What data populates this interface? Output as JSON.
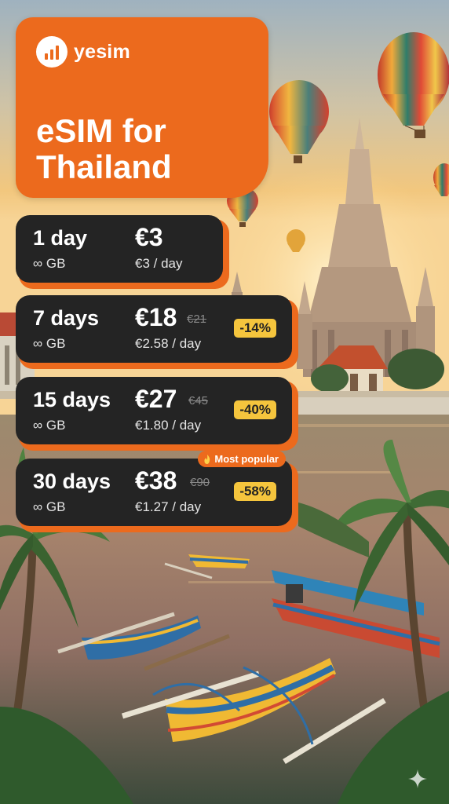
{
  "brand": {
    "name": "yesim",
    "logo_icon": "signal-bars-icon",
    "color": "#ec6a1d"
  },
  "hero": {
    "title": "eSIM for\nThailand"
  },
  "colors": {
    "accent": "#ec6a1d",
    "card": "#242424",
    "discount_badge": "#f5c53d"
  },
  "plans": [
    {
      "duration": "1 day",
      "data": "∞ GB",
      "price": "€3",
      "old_price": "",
      "per_day": "€3 / day",
      "discount": ""
    },
    {
      "duration": "7 days",
      "data": "∞ GB",
      "price": "€18",
      "old_price": "€21",
      "per_day": "€2.58 / day",
      "discount": "-14%"
    },
    {
      "duration": "15 days",
      "data": "∞ GB",
      "price": "€27",
      "old_price": "€45",
      "per_day": "€1.80 / day",
      "discount": "-40%"
    },
    {
      "duration": "30 days",
      "data": "∞ GB",
      "price": "€38",
      "old_price": "€90",
      "per_day": "€1.27 / day",
      "discount": "-58%",
      "badge": "Most popular",
      "badge_icon": "flame-icon"
    }
  ],
  "background": {
    "scene": "bangkok-temple-river-sunset",
    "icons": [
      "hot-air-balloon-icon",
      "temple-icon",
      "longtail-boat-icon",
      "palm-tree-icon"
    ]
  }
}
